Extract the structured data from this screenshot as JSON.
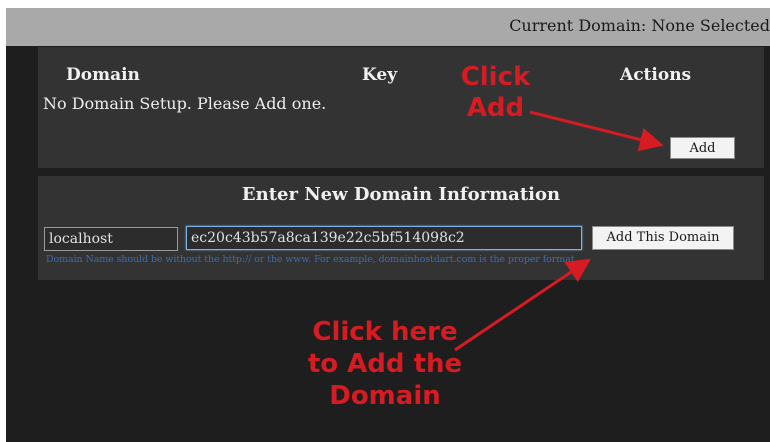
{
  "header": {
    "current_domain": "Current Domain: None Selected"
  },
  "domain_list": {
    "columns": [
      "Domain",
      "Key",
      "Actions"
    ],
    "empty_message": "No Domain Setup. Please Add one.",
    "add_button": "Add"
  },
  "new_domain_form": {
    "title": "Enter New Domain Information",
    "domain_value": "localhost",
    "key_value": "ec20c43b57a8ca139e22c5bf514098c2",
    "submit_button": "Add This Domain",
    "hint": "Domain Name should be without the http:// or the www. For example, domainhostdart.com is the proper format."
  },
  "annotations": {
    "callout_add_line1": "Click",
    "callout_add_line2": "Add",
    "callout_domain_line1": "Click here",
    "callout_domain_line2": "to Add the",
    "callout_domain_line3": "Domain"
  },
  "colors": {
    "background": "#1e1e1e",
    "panel": "#333333",
    "topbar": "#a9a9a9",
    "callout": "#d71b22",
    "hint": "#3f6ea6"
  }
}
